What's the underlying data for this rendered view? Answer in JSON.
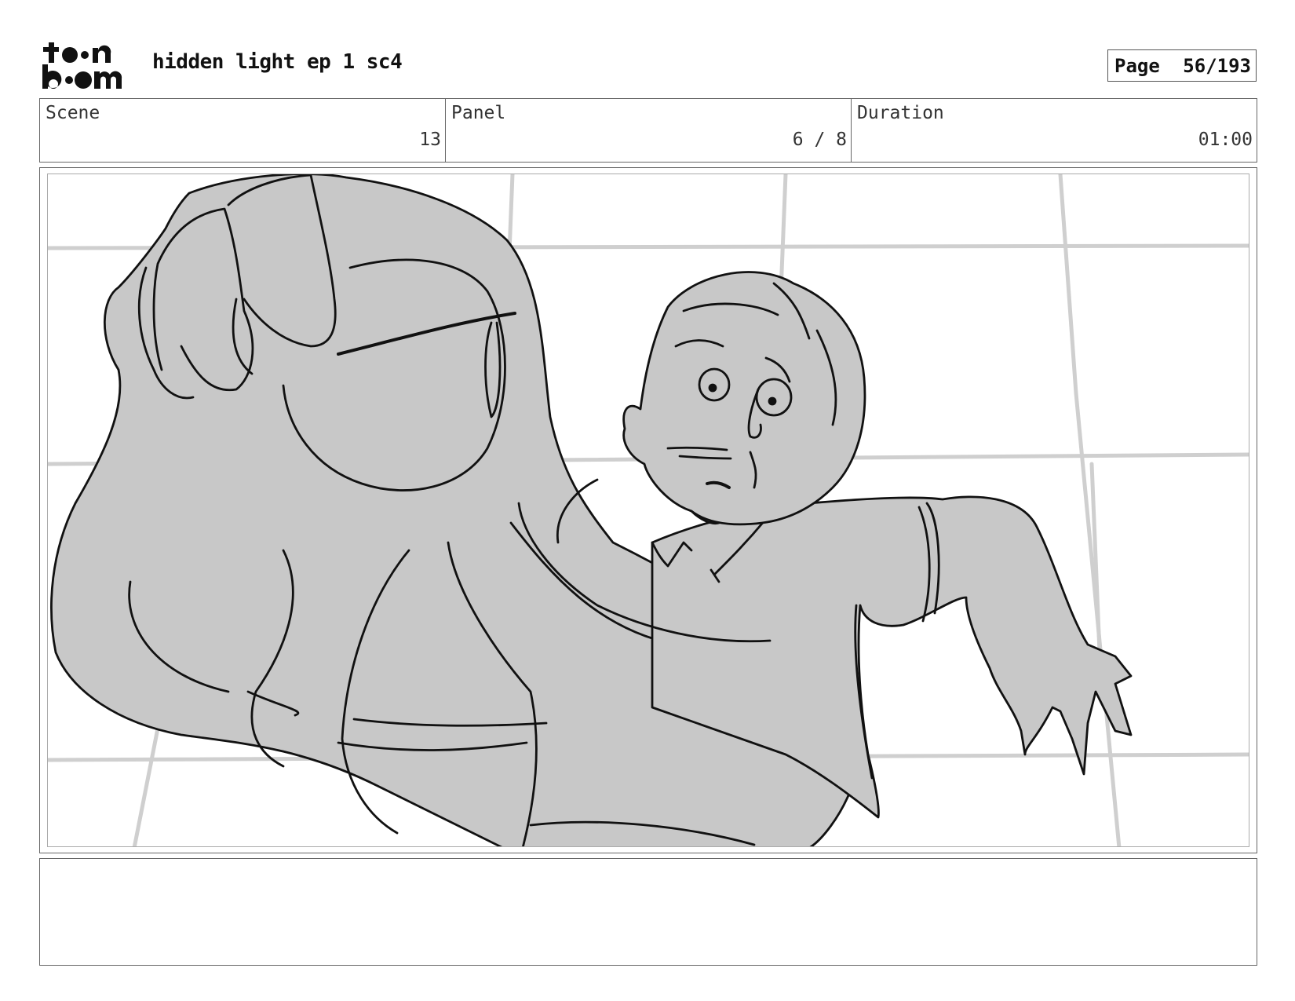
{
  "header": {
    "logo_text": "toonboom",
    "title": "hidden light ep 1 sc4",
    "page_label": "Page",
    "page_value": "56/193"
  },
  "info": {
    "scene": {
      "label": "Scene",
      "value": "13"
    },
    "panel": {
      "label": "Panel",
      "value": "6 / 8"
    },
    "duration": {
      "label": "Duration",
      "value": "01:00"
    }
  },
  "notes": {
    "text": ""
  },
  "colors": {
    "fill": "#c8c8c8",
    "line": "#111111",
    "grid": "#cfcfcf",
    "border": "#666666"
  }
}
